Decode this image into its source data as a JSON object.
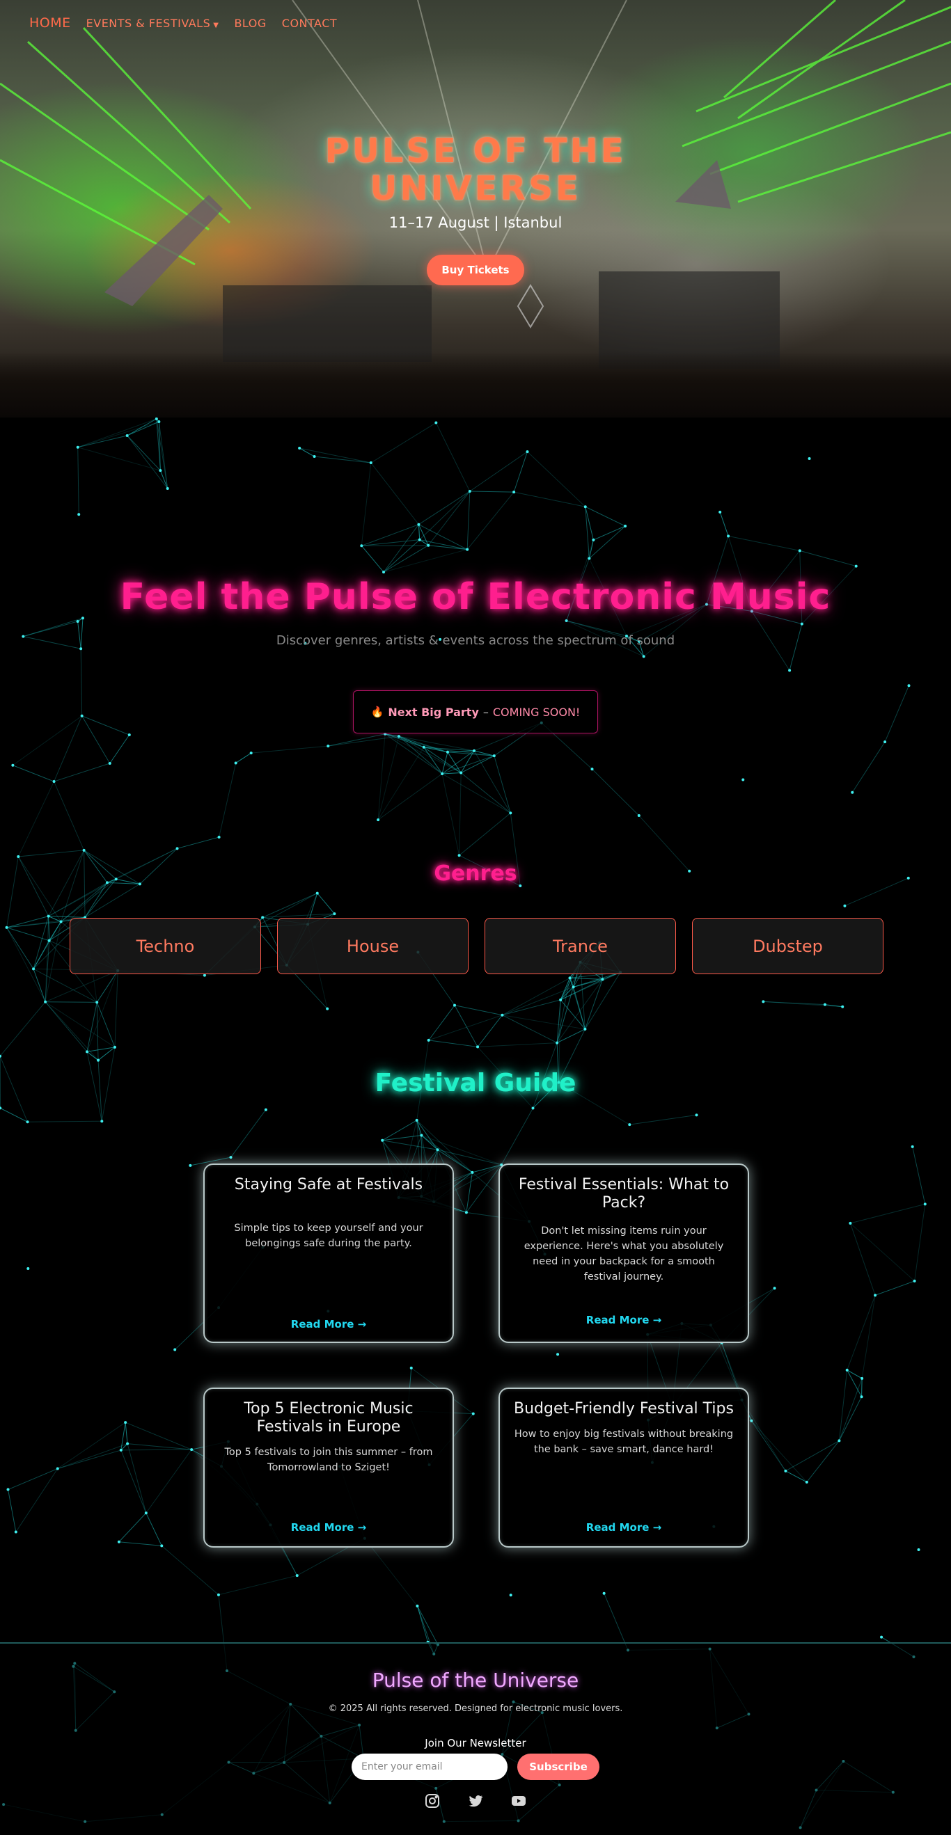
{
  "nav": {
    "home": "HOME",
    "events": "EVENTS & FESTIVALS",
    "blog": "BLOG",
    "contact": "CONTACT"
  },
  "hero": {
    "title_line1": "PULSE OF THE",
    "title_line2": "UNIVERSE",
    "date": "11–17 August | Istanbul",
    "buy_label": "Buy Tickets"
  },
  "intro": {
    "title": "Feel the Pulse of Electronic Music",
    "subtitle": "Discover genres, artists & events across the spectrum of sound",
    "badge_strong": "Next Big Party",
    "badge_dash": "–",
    "badge_soon": "COMING SOON!"
  },
  "genres": {
    "title": "Genres",
    "items": [
      "Techno",
      "House",
      "Trance",
      "Dubstep"
    ]
  },
  "guide": {
    "title": "Festival Guide",
    "cards": [
      {
        "title": "Staying Safe at Festivals",
        "text": "Simple tips to keep yourself and your belongings safe during the party.",
        "link": "Read More →"
      },
      {
        "title": "Festival Essentials: What to Pack?",
        "text": "Don't let missing items ruin your experience. Here's what you absolutely need in your backpack for a smooth festival journey.",
        "link": "Read More →"
      },
      {
        "title": "Top 5 Electronic Music Festivals in Europe",
        "text": "Top 5 festivals to join this summer – from Tomorrowland to Sziget!",
        "link": "Read More →"
      },
      {
        "title": "Budget-Friendly Festival Tips",
        "text": "How to enjoy big festivals without breaking the bank – save smart, dance hard!",
        "link": "Read More →"
      }
    ]
  },
  "footer": {
    "title": "Pulse of the Universe",
    "copyright": "© 2025 All rights reserved. Designed for electronic music lovers.",
    "newsletter_label": "Join Our Newsletter",
    "email_placeholder": "Enter your email",
    "subscribe_label": "Subscribe"
  },
  "colors": {
    "accent_pink": "#ff1f8e",
    "accent_cyan": "#20f0c8",
    "accent_coral": "#ff6a50"
  },
  "icons": [
    "instagram-icon",
    "twitter-icon",
    "youtube-icon"
  ]
}
